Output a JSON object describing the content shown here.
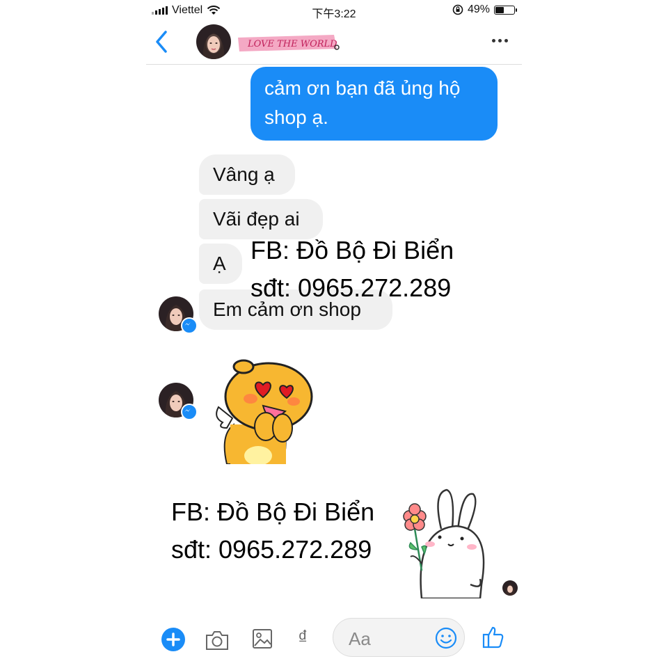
{
  "status_bar": {
    "carrier": "Viettel",
    "time": "下午3:22",
    "battery": "49%",
    "battery_level": 0.49
  },
  "header": {
    "name_banner": "LOVE THE WORLD",
    "back_icon": "chevron-left-icon",
    "more_icon": "more-dots-icon"
  },
  "messages": {
    "outgoing": "cảm ơn bạn đã ủng hộ shop ạ.",
    "incoming": [
      "Vâng ạ",
      "Vãi đẹp ai",
      "Ạ",
      "Em cảm ơn shop"
    ]
  },
  "overlay": {
    "fb_label": "FB: Đồ Bộ Đi Biển",
    "phone_label": "sđt: 0965.272.289"
  },
  "input_bar": {
    "placeholder": "Aa",
    "currency_symbol": "₫",
    "icons": [
      "plus-icon",
      "camera-icon",
      "image-icon",
      "emoji-icon",
      "thumbs-up-icon"
    ]
  },
  "colors": {
    "accent": "#1a8cf7",
    "bubble_in": "#f0f0f0",
    "text": "#111111"
  }
}
